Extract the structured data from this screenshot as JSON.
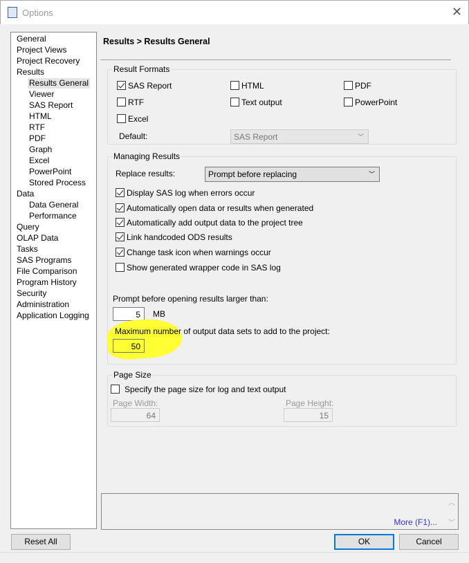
{
  "window": {
    "title": "Options",
    "close": "✕"
  },
  "tree": [
    {
      "label": "General",
      "level": 0
    },
    {
      "label": "Project Views",
      "level": 0
    },
    {
      "label": "Project Recovery",
      "level": 0
    },
    {
      "label": "Results",
      "level": 0
    },
    {
      "label": "Results General",
      "level": 1,
      "selected": true
    },
    {
      "label": "Viewer",
      "level": 1
    },
    {
      "label": "SAS Report",
      "level": 1
    },
    {
      "label": "HTML",
      "level": 1
    },
    {
      "label": "RTF",
      "level": 1
    },
    {
      "label": "PDF",
      "level": 1
    },
    {
      "label": "Graph",
      "level": 1
    },
    {
      "label": "Excel",
      "level": 1
    },
    {
      "label": "PowerPoint",
      "level": 1
    },
    {
      "label": "Stored Process",
      "level": 1
    },
    {
      "label": "Data",
      "level": 0
    },
    {
      "label": "Data General",
      "level": 1
    },
    {
      "label": "Performance",
      "level": 1
    },
    {
      "label": "Query",
      "level": 0
    },
    {
      "label": "OLAP Data",
      "level": 0
    },
    {
      "label": "Tasks",
      "level": 0
    },
    {
      "label": "SAS Programs",
      "level": 0
    },
    {
      "label": "File Comparison",
      "level": 0
    },
    {
      "label": "Program History",
      "level": 0
    },
    {
      "label": "Security",
      "level": 0
    },
    {
      "label": "Administration",
      "level": 0
    },
    {
      "label": "Application Logging",
      "level": 0
    }
  ],
  "breadcrumb": "Results > Results General",
  "formats": {
    "title": "Result Formats",
    "items": [
      {
        "label": "SAS Report",
        "checked": true
      },
      {
        "label": "HTML",
        "checked": false
      },
      {
        "label": "PDF",
        "checked": false
      },
      {
        "label": "RTF",
        "checked": false
      },
      {
        "label": "Text output",
        "checked": false
      },
      {
        "label": "PowerPoint",
        "checked": false
      },
      {
        "label": "Excel",
        "checked": false
      }
    ],
    "default_label": "Default:",
    "default_value": "SAS Report"
  },
  "managing": {
    "title": "Managing Results",
    "replace_label": "Replace results:",
    "replace_value": "Prompt before replacing",
    "options": [
      {
        "label": "Display SAS log when errors occur",
        "checked": true
      },
      {
        "label": "Automatically open data or results when generated",
        "checked": true
      },
      {
        "label": "Automatically add output data to the project tree",
        "checked": true
      },
      {
        "label": "Link handcoded ODS results",
        "checked": true
      },
      {
        "label": "Change task icon when warnings occur",
        "checked": true
      },
      {
        "label": "Show generated wrapper code in SAS log",
        "checked": false
      }
    ],
    "prompt_label": "Prompt before opening results larger than:",
    "prompt_value": "5",
    "prompt_unit": "MB",
    "max_label": "Maximum number of output data sets to add to the project:",
    "max_value": "50"
  },
  "page_size": {
    "title": "Page Size",
    "specify_label": "Specify the page size for log and text output",
    "width_label": "Page Width:",
    "width_value": "64",
    "height_label": "Page Height:",
    "height_value": "15"
  },
  "help": {
    "more_link": "More (F1)..."
  },
  "buttons": {
    "reset": "Reset All",
    "ok": "OK",
    "cancel": "Cancel"
  },
  "colors": {
    "highlight": "#ffff33",
    "link": "#3333cc",
    "ok_border": "#0078d7"
  }
}
